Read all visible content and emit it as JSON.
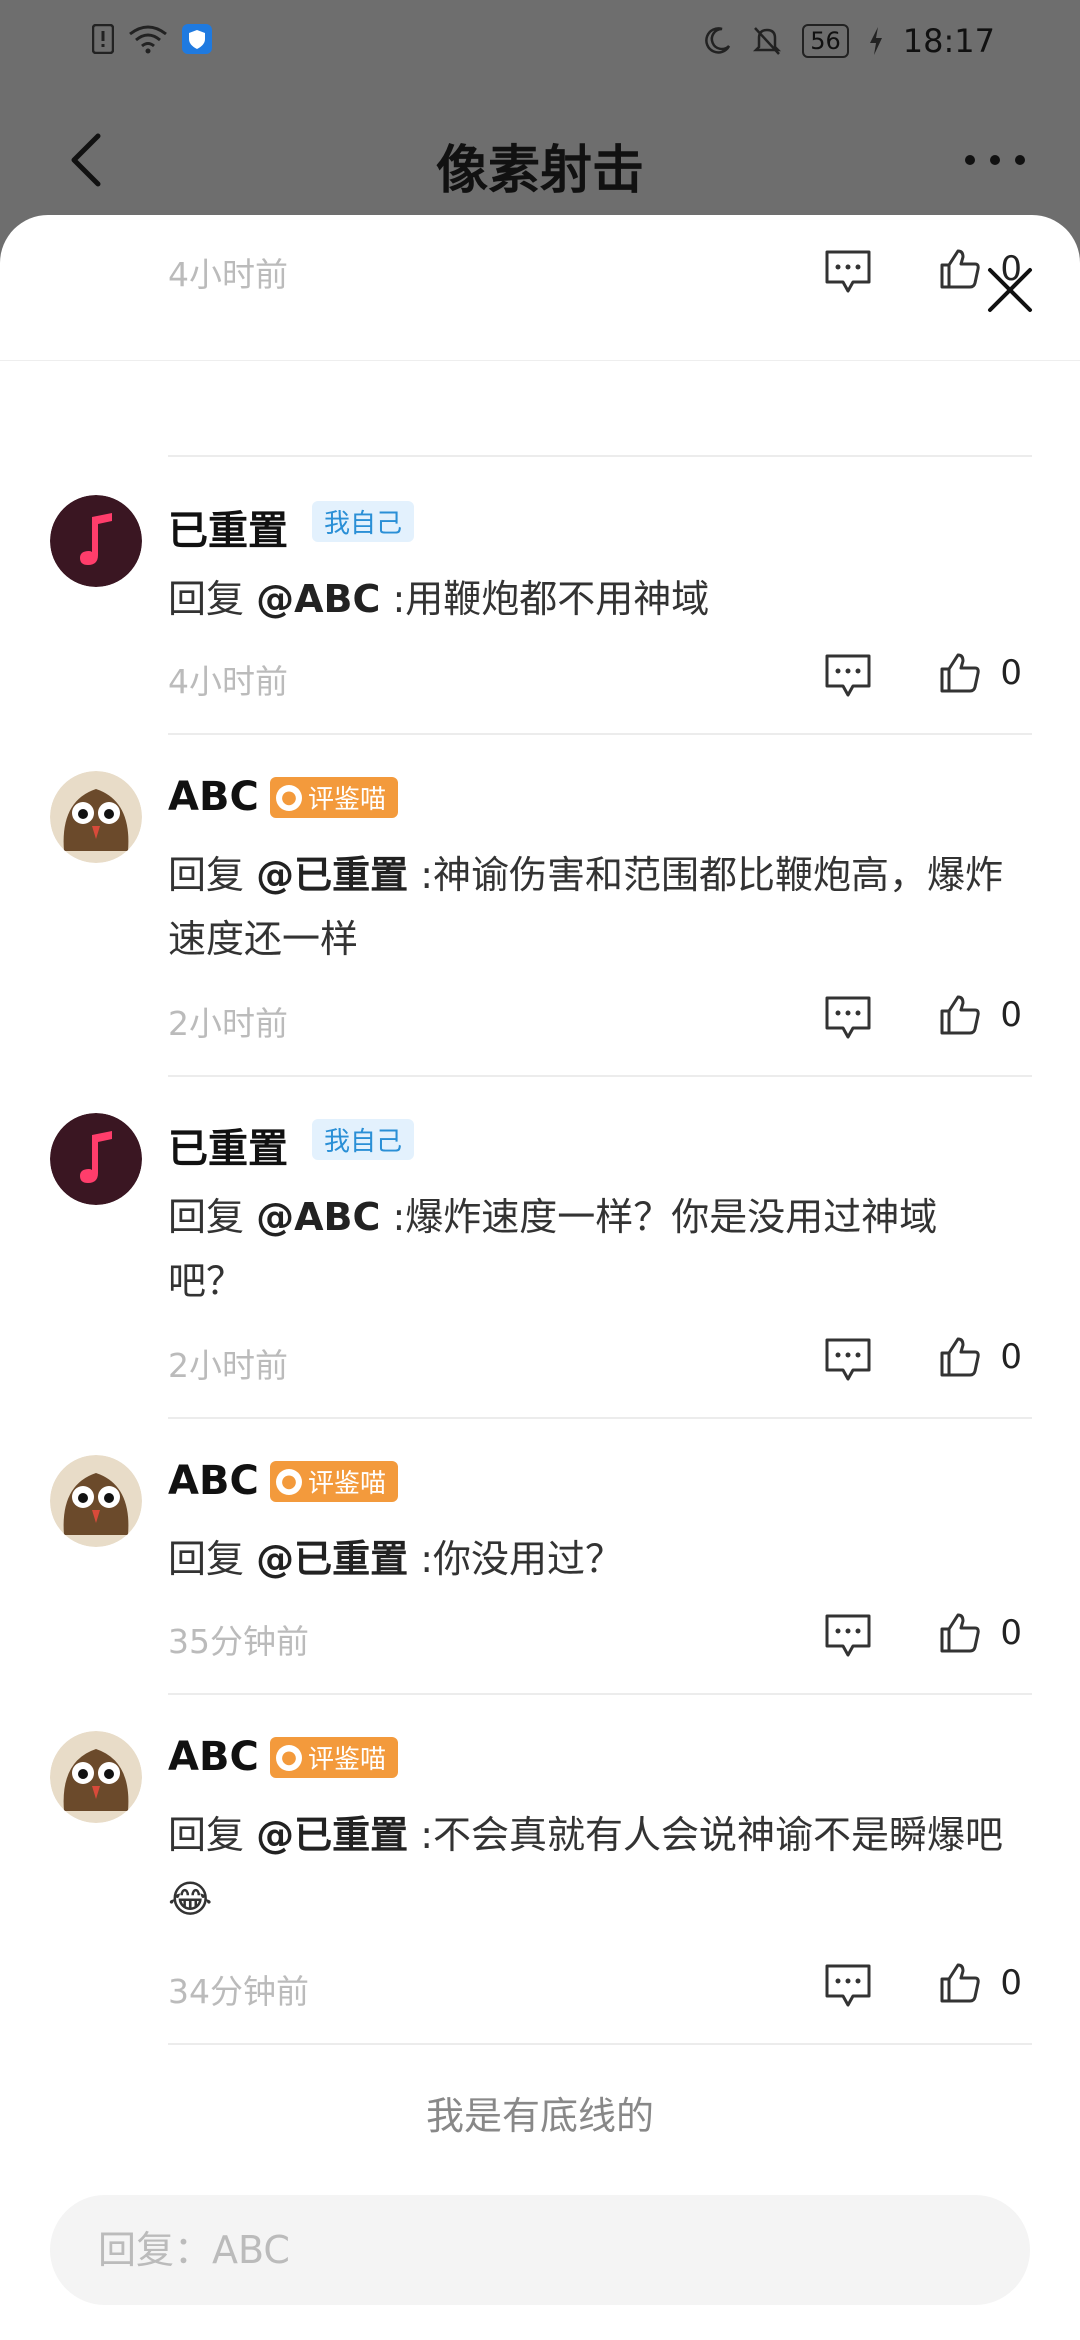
{
  "status_bar": {
    "time": "18:17",
    "battery": "56"
  },
  "header": {
    "title": "像素射击"
  },
  "comments": [
    {
      "time": "4小时前",
      "likes": "0"
    },
    {
      "user": "已重置",
      "badge": "我自己",
      "reply_prefix": "回复 ",
      "mention": "@ABC",
      "text": " :用鞭炮都不用神域",
      "time": "4小时前",
      "likes": "0"
    },
    {
      "user": "ABC",
      "badge": "评鉴喵",
      "reply_prefix": "回复 ",
      "mention": "@已重置",
      "text": " :神谕伤害和范围都比鞭炮高，爆炸速度还一样",
      "time": "2小时前",
      "likes": "0"
    },
    {
      "user": "已重置",
      "badge": "我自己",
      "reply_prefix": "回复 ",
      "mention": "@ABC",
      "text": " :爆炸速度一样？你是没用过神域吧？",
      "time": "2小时前",
      "likes": "0"
    },
    {
      "user": "ABC",
      "badge": "评鉴喵",
      "reply_prefix": "回复 ",
      "mention": "@已重置",
      "text": " :你没用过？",
      "time": "35分钟前",
      "likes": "0"
    },
    {
      "user": "ABC",
      "badge": "评鉴喵",
      "reply_prefix": "回复 ",
      "mention": "@已重置",
      "text": " :不会真就有人会说神谕不是瞬爆吧😂",
      "time": "34分钟前",
      "likes": "0"
    }
  ],
  "footer_note": "我是有底线的",
  "reply_input": {
    "placeholder": "回复：ABC"
  },
  "colors": {
    "self_badge": "#2a8fd6",
    "mew_badge": "#f39a3c",
    "time_text": "#bbbbbb"
  }
}
